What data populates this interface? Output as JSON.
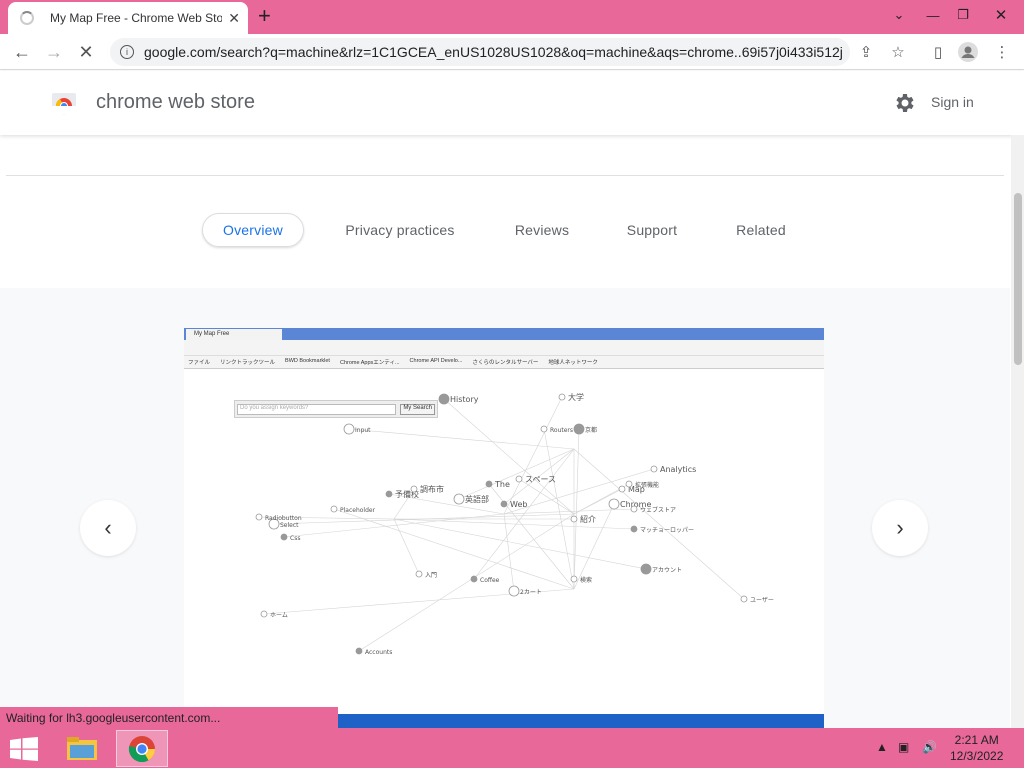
{
  "browser": {
    "tab_title": "My Map Free - Chrome Web Store",
    "url": "google.com/search?q=machine&rlz=1C1GCEA_enUS1028US1028&oq=machine&aqs=chrome..69i57j0i433i512j..."
  },
  "store": {
    "title": "chrome web store",
    "sign_in": "Sign in"
  },
  "nav_tabs": [
    {
      "label": "Overview"
    },
    {
      "label": "Privacy practices"
    },
    {
      "label": "Reviews"
    },
    {
      "label": "Support"
    },
    {
      "label": "Related"
    }
  ],
  "screenshot": {
    "tab_label": "My Map Free",
    "search_placeholder": "Do you assign keywords?",
    "search_button": "My Search",
    "bookmarks": [
      "ファイル",
      "リンクトラックツール",
      "BWD Bookmarklet",
      "Chrome Appsエンティ...",
      "Chrome API Develo...",
      "さくらのレンタルサーバー",
      "地球人ネットワーク"
    ],
    "nodes": [
      "History",
      "大学",
      "紹介",
      "Web",
      "Chrome",
      "Map",
      "予備校",
      "調布市",
      "英語部",
      "The",
      "スペース",
      "Analytics",
      "アカウント",
      "ユーザー",
      "ホーム",
      "Accounts",
      "2カート",
      "入門",
      "Coffee",
      "Placeholder",
      "Select",
      "Css",
      "Radiobutton",
      "検索",
      "京都",
      "拡張機能",
      "ウェブストア",
      "マッチョーロッパー",
      "Input",
      "Routers"
    ]
  },
  "status_text": "Waiting for lh3.googleusercontent.com...",
  "taskbar": {
    "time": "2:21 AM",
    "date": "12/3/2022"
  },
  "colors": {
    "tab_strip": "#e8689a",
    "active_nav": "#1a73e8"
  }
}
